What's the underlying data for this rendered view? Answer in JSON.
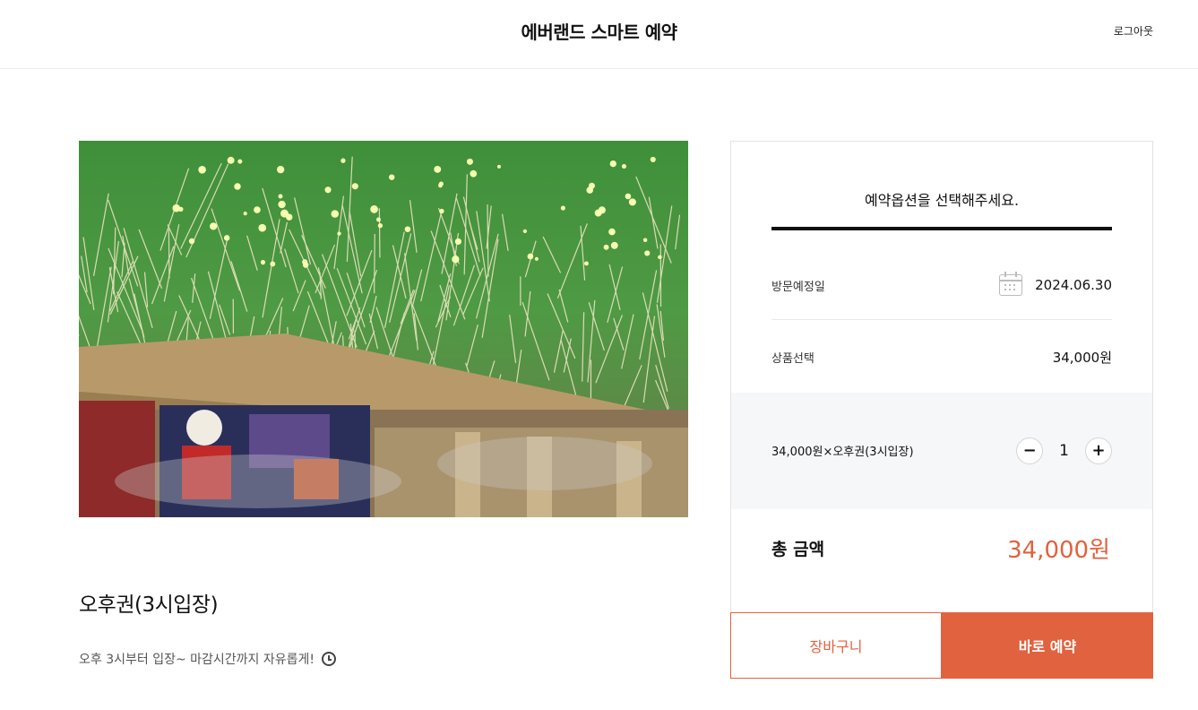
{
  "header": {
    "title": "에버랜드 스마트 예약",
    "logout_label": "로그아웃"
  },
  "product": {
    "image_icon": "fireworks-photo",
    "title": "오후권(3시입장)",
    "description": "오후 3시부터 입장~ 마감시간까지 자유롭게!",
    "description_icon": "clock-icon"
  },
  "booking": {
    "heading": "예약옵션을 선택해주세요.",
    "visit_date_label": "방문예정일",
    "visit_date_icon": "calendar-icon",
    "visit_date_value": "2024.06.30",
    "product_select_label": "상품선택",
    "product_price": "34,000원",
    "option": {
      "label": "34,000원×오후권(3시입장)",
      "quantity": "1",
      "minus_label": "−",
      "plus_label": "+"
    },
    "total_label": "총 금액",
    "total_value": "34,000원"
  },
  "actions": {
    "cart_label": "장바구니",
    "book_label": "바로 예약"
  },
  "colors": {
    "accent": "#e0623e",
    "panel_bg": "#f6f7f8"
  }
}
